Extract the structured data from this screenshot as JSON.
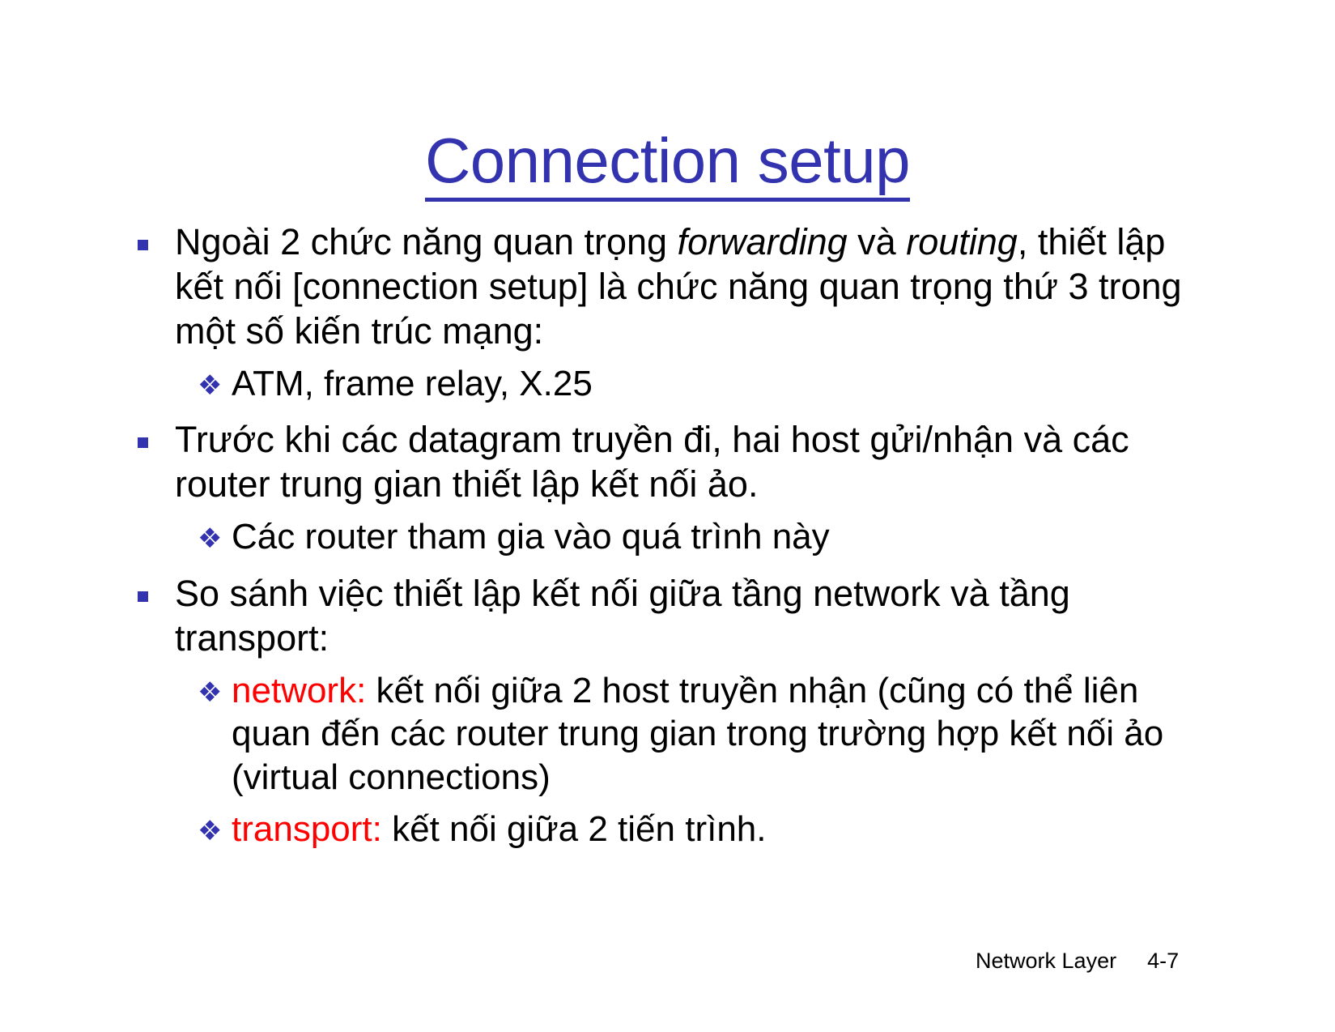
{
  "slide": {
    "title": "Connection setup",
    "title_color": "#3333b0",
    "accent_color": "#3333b0",
    "highlight_color": "#ff0000",
    "background_color": "#ffffff"
  },
  "markers": {
    "level1": "square-bullet",
    "level2": "❖"
  },
  "content": [
    {
      "level": 1,
      "lines": [
        "Ngoài 2 chức năng quan trọng ",
        "forwarding",
        " và ",
        "routing",
        ", thiết lập kết nối [connection setup] là chức năng quan trọng thứ 3 trong một số kiến trúc mạng:"
      ],
      "plain": "Ngoài 2 chức năng quan trọng forwarding và routing, thiết lập kết nối [connection setup] là chức năng quan trọng thứ 3 trong một số kiến trúc mạng:"
    },
    {
      "level": 2,
      "plain": "ATM, frame relay, X.25"
    },
    {
      "level": 1,
      "plain": "Trước khi các datagram truyền đi, hai host gửi/nhận và các router trung gian thiết lập kết nối ảo."
    },
    {
      "level": 2,
      "plain": "Các router tham gia vào quá trình này"
    },
    {
      "level": 1,
      "plain": "So sánh việc thiết lập kết nối giữa tầng network và tầng transport:"
    },
    {
      "level": 2,
      "label": "network:",
      "plain": " kết nối giữa 2 host truyền nhận (cũng có thể liên quan đến các router trung gian trong trường hợp kết nối ảo (virtual connections)"
    },
    {
      "level": 2,
      "label": "transport:",
      "plain": " kết nối giữa 2 tiến trình."
    }
  ],
  "bullet1": {
    "part_a": "Ngoài 2 chức năng quan trọng ",
    "italic_a": "forwarding",
    "part_b": " và ",
    "italic_b": "routing",
    "part_c": ", thiết lập kết nối [connection setup] là chức năng quan trọng thứ 3 trong một số kiến trúc mạng:"
  },
  "bullet2": {
    "text": "ATM, frame relay, X.25"
  },
  "bullet3": {
    "text": "Trước khi các datagram truyền đi, hai host gửi/nhận và các router trung gian thiết lập kết nối ảo."
  },
  "bullet4": {
    "text": "Các router tham gia vào quá trình này"
  },
  "bullet5": {
    "text": "So sánh việc thiết lập kết nối giữa tầng network và tầng transport:"
  },
  "bullet6": {
    "label": "network:",
    "text": " kết nối giữa 2 host truyền nhận (cũng có thể liên quan đến các router trung gian trong trường hợp kết nối ảo (virtual connections)"
  },
  "bullet7": {
    "label": "transport:",
    "text": " kết nối giữa 2 tiến trình."
  },
  "footer": {
    "label": "Network Layer",
    "page": "4-7"
  }
}
